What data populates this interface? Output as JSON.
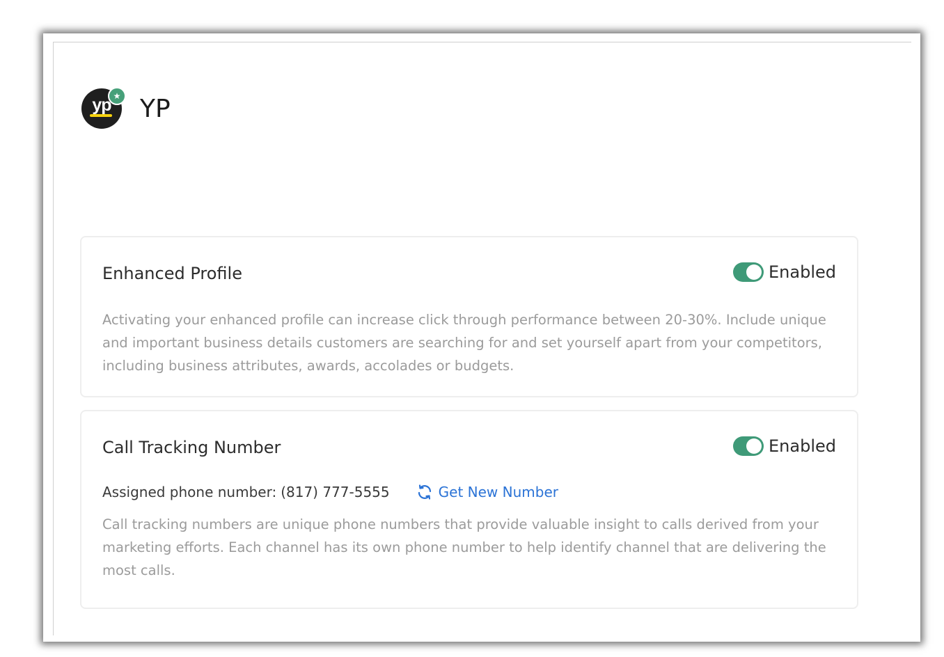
{
  "header": {
    "logo_text": "yp",
    "logo_badge_icon": "star-icon",
    "title": "YP"
  },
  "colors": {
    "toggle_on": "#3f9a78",
    "link": "#2b73d6",
    "logo_badge": "#46a079",
    "logo_underline": "#f6d20d"
  },
  "enhanced_profile": {
    "title": "Enhanced Profile",
    "toggle_state": true,
    "toggle_label": "Enabled",
    "description": "Activating your enhanced profile can increase click through performance between 20-30%. Include unique and important business details customers are searching for and set yourself apart from your competitors, including business attributes, awards, accolades or budgets."
  },
  "call_tracking": {
    "title": "Call Tracking Number",
    "toggle_state": true,
    "toggle_label": "Enabled",
    "assigned_label": "Assigned phone number:",
    "assigned_number": "(817) 777-5555",
    "get_new_label": "Get New Number",
    "get_new_icon": "refresh-icon",
    "description": "Call tracking numbers are unique phone numbers that provide valuable insight to calls derived from your marketing efforts. Each channel has its own phone number to help identify channel that are delivering the most calls."
  }
}
